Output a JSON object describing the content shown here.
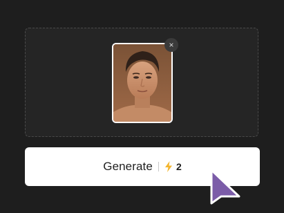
{
  "upload": {
    "thumbnail_icon": "portrait-photo",
    "remove_label": "×"
  },
  "generate": {
    "label": "Generate",
    "credit_icon": "lightning-bolt-icon",
    "credit_cost": "2"
  },
  "colors": {
    "background": "#1e1e1e",
    "dropzone": "#252525",
    "button": "#ffffff",
    "bolt": "#f3b52d",
    "cursor": "#7b5ca8"
  }
}
